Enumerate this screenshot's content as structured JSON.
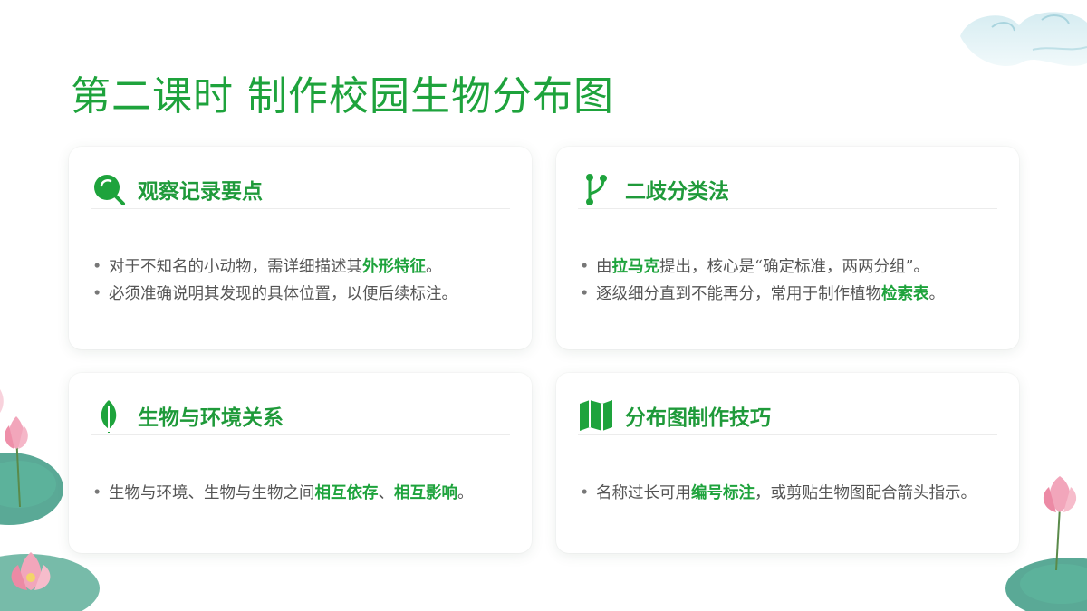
{
  "title": "第二课时 制作校园生物分布图",
  "accent_color": "#1ea33c",
  "cards": [
    {
      "icon": "magnifier-icon",
      "title": "观察记录要点",
      "bullets": [
        {
          "pre": "对于不知名的小动物，需详细描述其",
          "hl": "外形特征",
          "post": "。"
        },
        {
          "pre": "必须准确说明其发现的具体位置，以便后续标注。"
        }
      ]
    },
    {
      "icon": "branch-icon",
      "title": "二歧分类法",
      "bullets": [
        {
          "pre": "由",
          "hl": "拉马克",
          "post": "提出，核心是“确定标准，两两分组”。"
        },
        {
          "pre": "逐级细分直到不能再分，常用于制作植物",
          "hl": "检索表",
          "post": "。"
        }
      ]
    },
    {
      "icon": "leaf-icon",
      "title": "生物与环境关系",
      "bullets": [
        {
          "pre": "生物与环境、生物与生物之间",
          "hl": "相互依存",
          "mid": "、",
          "hl2": "相互影响",
          "post": "。"
        }
      ]
    },
    {
      "icon": "map-icon",
      "title": "分布图制作技巧",
      "bullets": [
        {
          "pre": "名称过长可用",
          "hl": "编号标注",
          "post": "，或剪贴生物图配合箭头指示。"
        }
      ]
    }
  ]
}
